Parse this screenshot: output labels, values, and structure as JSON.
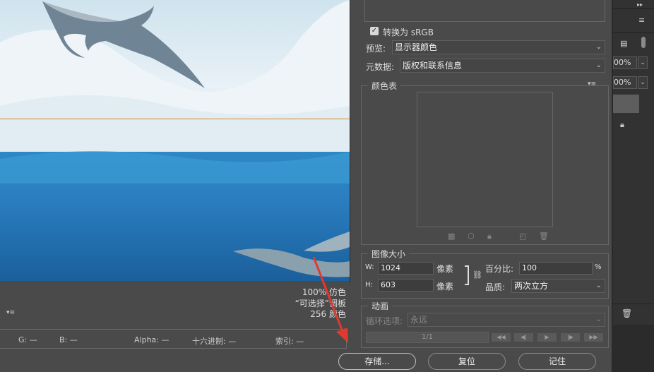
{
  "preview": {
    "info": {
      "dither": "100% 仿色",
      "palette": "“可选择”调板",
      "colors": "256 颜色"
    }
  },
  "statusbar": {
    "g": "G: —",
    "b": "B: —",
    "alpha": "Alpha: —",
    "hex": "十六进制: —",
    "index": "索引: —"
  },
  "settings": {
    "convert_srgb": "转换为 sRGB",
    "convert_checked": true,
    "preview_label": "预览:",
    "preview_value": "显示器颜色",
    "metadata_label": "元数据:",
    "metadata_value": "版权和联系信息"
  },
  "color_table": {
    "title": "颜色表"
  },
  "image_size": {
    "title": "图像大小",
    "w_label": "W:",
    "w_value": "1024",
    "w_unit": "像素",
    "h_label": "H:",
    "h_value": "603",
    "h_unit": "像素",
    "percent_label": "百分比:",
    "percent_value": "100",
    "percent_unit": "%",
    "quality_label": "品质:",
    "quality_value": "两次立方"
  },
  "animation": {
    "title": "动画",
    "loop_label": "循环选项:",
    "loop_value": "永远",
    "frame": "1/1"
  },
  "buttons": {
    "save": "存储...",
    "reset": "复位",
    "remember": "记住"
  },
  "app_right": {
    "opacity1": "00%",
    "opacity2": "00%"
  }
}
